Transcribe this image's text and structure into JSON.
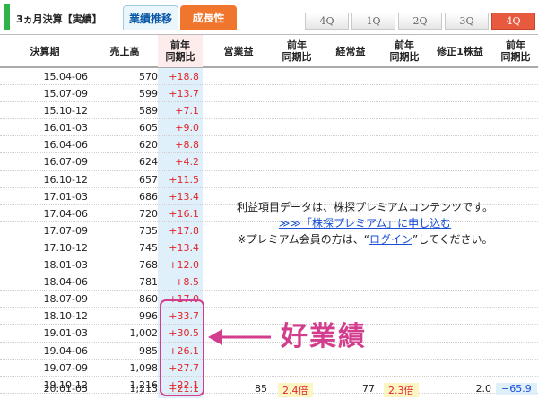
{
  "header": {
    "title": "3ヵ月決算【実績】",
    "tab_results": "業績推移",
    "tab_growth": "成長性",
    "quarters": [
      "4Q",
      "1Q",
      "2Q",
      "3Q",
      "4Q"
    ],
    "active_quarter_index": 4
  },
  "columns": {
    "period": "決算期",
    "sales": "売上高",
    "yoy1": "前年\n同期比",
    "operating": "営業益",
    "yoy2": "前年\n同期比",
    "ordinary": "経常益",
    "yoy3": "前年\n同期比",
    "eps": "修正1株益",
    "yoy4": "前年\n同期比"
  },
  "rows": [
    {
      "period": "15.04-06",
      "sales": "570",
      "yoy": "+18.8"
    },
    {
      "period": "15.07-09",
      "sales": "599",
      "yoy": "+13.7"
    },
    {
      "period": "15.10-12",
      "sales": "589",
      "yoy": "+7.1"
    },
    {
      "period": "16.01-03",
      "sales": "605",
      "yoy": "+9.0"
    },
    {
      "period": "16.04-06",
      "sales": "620",
      "yoy": "+8.8"
    },
    {
      "period": "16.07-09",
      "sales": "624",
      "yoy": "+4.2"
    },
    {
      "period": "16.10-12",
      "sales": "657",
      "yoy": "+11.5"
    },
    {
      "period": "17.01-03",
      "sales": "686",
      "yoy": "+13.4"
    },
    {
      "period": "17.04-06",
      "sales": "720",
      "yoy": "+16.1"
    },
    {
      "period": "17.07-09",
      "sales": "735",
      "yoy": "+17.8"
    },
    {
      "period": "17.10-12",
      "sales": "745",
      "yoy": "+13.4"
    },
    {
      "period": "18.01-03",
      "sales": "768",
      "yoy": "+12.0"
    },
    {
      "period": "18.04-06",
      "sales": "781",
      "yoy": "+8.5"
    },
    {
      "period": "18.07-09",
      "sales": "860",
      "yoy": "+17.0"
    },
    {
      "period": "18.10-12",
      "sales": "996",
      "yoy": "+33.7"
    },
    {
      "period": "19.01-03",
      "sales": "1,002",
      "yoy": "+30.5"
    },
    {
      "period": "19.04-06",
      "sales": "985",
      "yoy": "+26.1"
    },
    {
      "period": "19.07-09",
      "sales": "1,098",
      "yoy": "+27.7"
    },
    {
      "period": "19.10-12",
      "sales": "1,216",
      "yoy": "+22.1"
    }
  ],
  "last_row": {
    "period": "20.01-03",
    "sales": "1,213",
    "yoy": "+21.1",
    "operating": "85",
    "operating_yoy": "2.4倍",
    "ordinary": "77",
    "ordinary_yoy": "2.3倍",
    "eps": "2.0",
    "eps_yoy": "−65.9"
  },
  "premium_message": {
    "line1": "利益項目データは、株探プレミアムコンテンツです。",
    "line2_link": "≫≫「株探プレミアム」に申し込む",
    "line3_prefix": "※プレミアム会員の方は、“",
    "line3_link": "ログイン",
    "line3_suffix": "”してください。"
  },
  "annotation": {
    "label": "好業績"
  },
  "colors": {
    "accent_green": "#2db34a",
    "tab_orange": "#f0762d",
    "active_q": "#e85a3e",
    "annotation_pink": "#d33d8e",
    "positive_red": "#e2252b",
    "link_blue": "#1a4fd6"
  }
}
